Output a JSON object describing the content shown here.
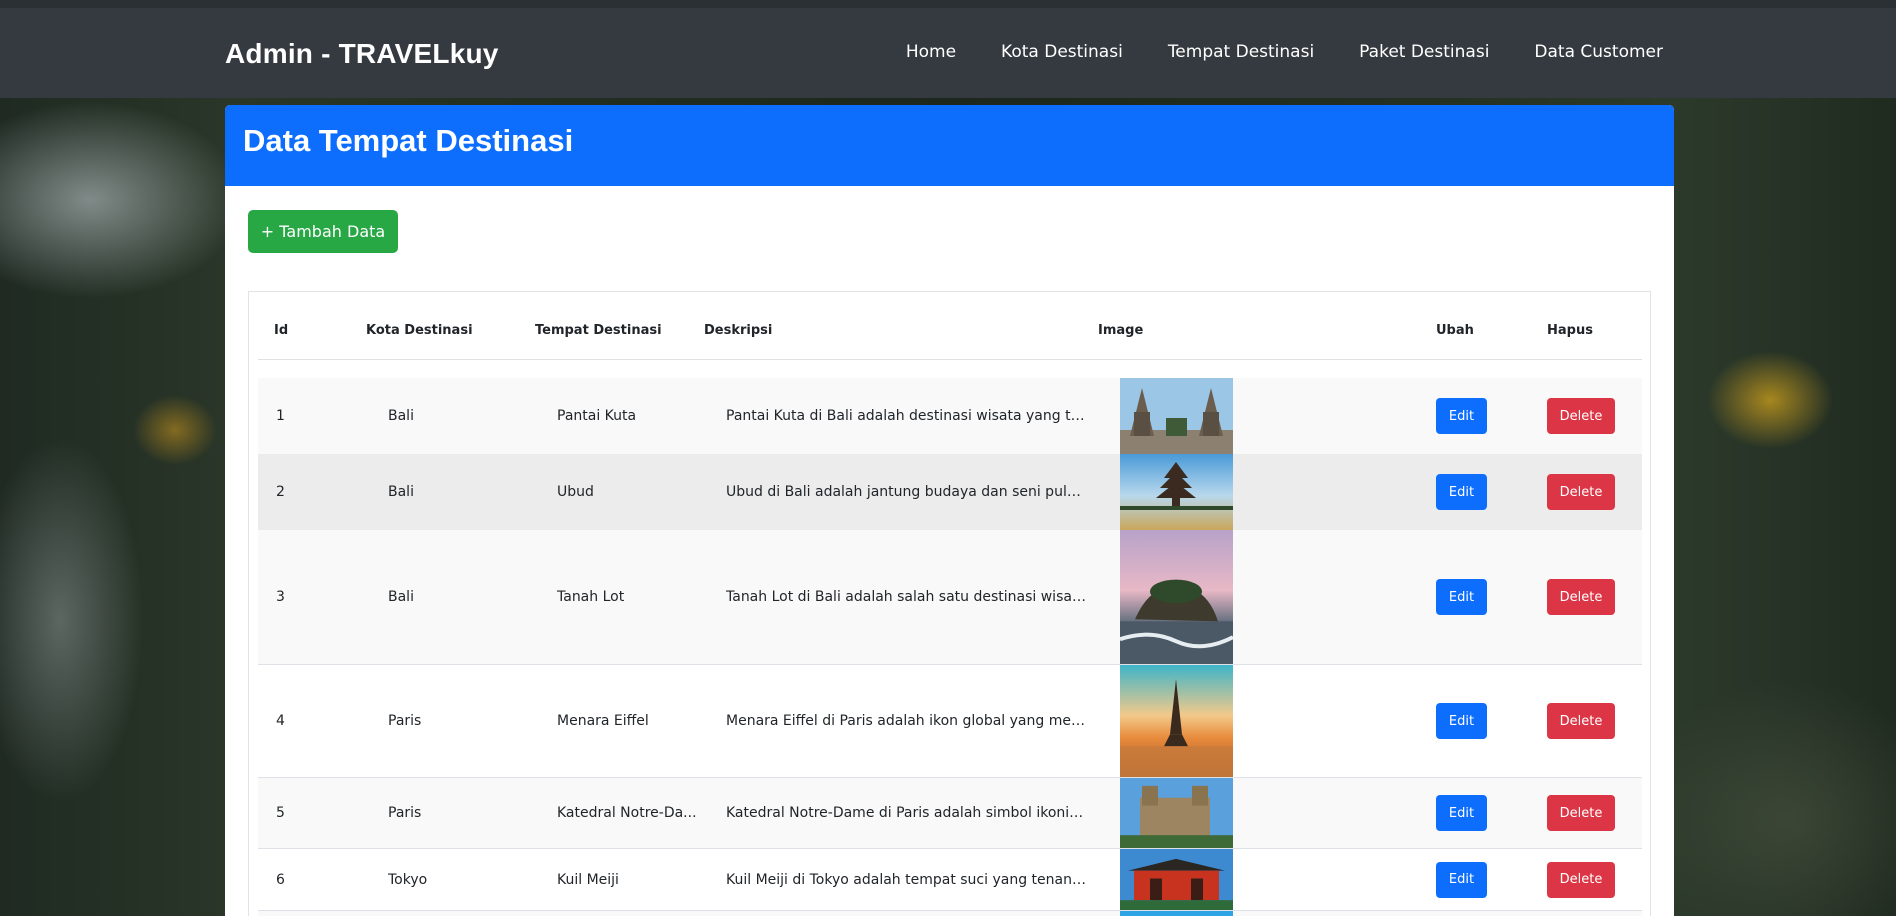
{
  "header": {
    "brand": "Admin - TRAVELkuy",
    "nav": [
      "Home",
      "Kota Destinasi",
      "Tempat Destinasi",
      "Paket Destinasi",
      "Data Customer"
    ]
  },
  "page": {
    "title": "Data Tempat Destinasi",
    "add_button": "+ Tambah Data"
  },
  "table": {
    "columns": [
      "Id",
      "Kota Destinasi",
      "Tempat Destinasi",
      "Deskripsi",
      "Image",
      "Ubah",
      "Hapus"
    ],
    "edit_label": "Edit",
    "delete_label": "Delete",
    "rows": [
      {
        "id": "1",
        "kota": "Bali",
        "tempat": "Pantai Kuta",
        "deskripsi": "Pantai Kuta di Bali adalah destinasi wisata yang terke...",
        "image": "bali-gate-photo"
      },
      {
        "id": "2",
        "kota": "Bali",
        "tempat": "Ubud",
        "deskripsi": "Ubud di Bali adalah jantung budaya dan seni pulau in...",
        "image": "bali-temple-lake-photo"
      },
      {
        "id": "3",
        "kota": "Bali",
        "tempat": "Tanah Lot",
        "deskripsi": "Tanah Lot di Bali adalah salah satu destinasi wisata pa...",
        "image": "tanah-lot-photo"
      },
      {
        "id": "4",
        "kota": "Paris",
        "tempat": "Menara Eiffel",
        "deskripsi": "Menara Eiffel di Paris adalah ikon global yang melam...",
        "image": "eiffel-tower-photo"
      },
      {
        "id": "5",
        "kota": "Paris",
        "tempat": "Katedral Notre-Da...",
        "deskripsi": "Katedral Notre-Dame di Paris adalah simbol ikonik de...",
        "image": "notre-dame-photo"
      },
      {
        "id": "6",
        "kota": "Tokyo",
        "tempat": "Kuil Meiji",
        "deskripsi": "Kuil Meiji di Tokyo adalah tempat suci yang tenang d...",
        "image": "meiji-shrine-photo"
      }
    ]
  }
}
